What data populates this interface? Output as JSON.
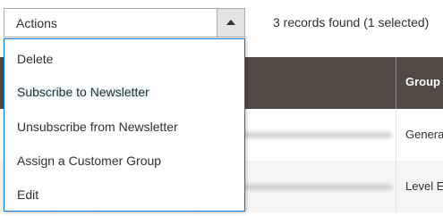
{
  "toolbar": {
    "actions_label": "Actions",
    "records_text": "3 records found (1 selected)"
  },
  "actions_menu": {
    "items": [
      {
        "label": "Delete"
      },
      {
        "label": "Subscribe to Newsletter",
        "state": "hovered"
      },
      {
        "label": "Unsubscribe from Newsletter"
      },
      {
        "label": "Assign a Customer Group"
      },
      {
        "label": "Edit"
      }
    ]
  },
  "grid": {
    "columns": [
      {
        "label": "Group"
      }
    ],
    "rows": [
      {
        "group": "Genera"
      },
      {
        "group": "Level E"
      }
    ]
  },
  "colors": {
    "header_bg": "#514943",
    "menu_border": "#007bdb",
    "hover_glow": "#b7dff2"
  }
}
